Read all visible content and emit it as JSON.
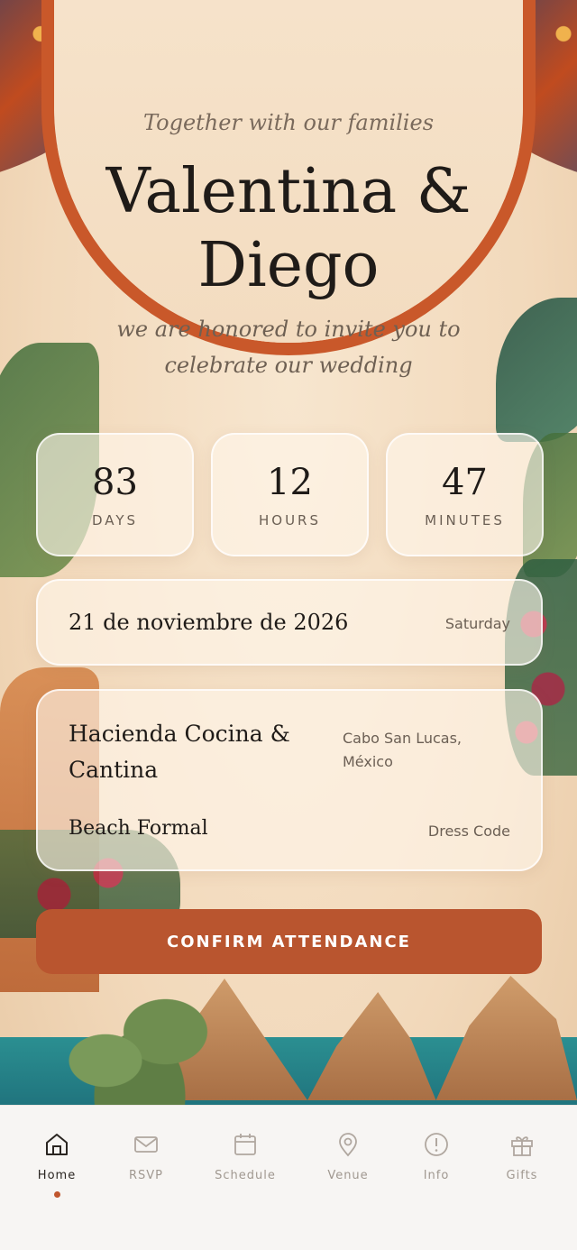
{
  "header": {
    "intro": "Together with our families",
    "name_line1": "Valentina &",
    "name_line2": "Diego",
    "invite_line1": "we are honored to invite you to",
    "invite_line2": "celebrate our wedding"
  },
  "countdown": [
    {
      "value": "83",
      "label": "DAYS"
    },
    {
      "value": "12",
      "label": "HOURS"
    },
    {
      "value": "47",
      "label": "MINUTES"
    }
  ],
  "date": {
    "full": "21 de noviembre de 2026",
    "weekday": "Saturday"
  },
  "venue": {
    "name": "Hacienda Cocina & Cantina",
    "city": "Cabo San Lucas, México",
    "dress_code": "Beach Formal",
    "dress_code_label": "Dress Code"
  },
  "cta": {
    "label": "CONFIRM ATTENDANCE"
  },
  "tabs": [
    {
      "label": "Home",
      "icon": "home-icon",
      "active": true
    },
    {
      "label": "RSVP",
      "icon": "mail-icon"
    },
    {
      "label": "Schedule",
      "icon": "calendar-icon"
    },
    {
      "label": "Venue",
      "icon": "map-pin-icon"
    },
    {
      "label": "Info",
      "icon": "info-icon"
    },
    {
      "label": "Gifts",
      "icon": "gift-icon"
    }
  ],
  "colors": {
    "accent": "#b9552f",
    "background": "#f3dcc0",
    "active_dot": "#c0562d"
  }
}
